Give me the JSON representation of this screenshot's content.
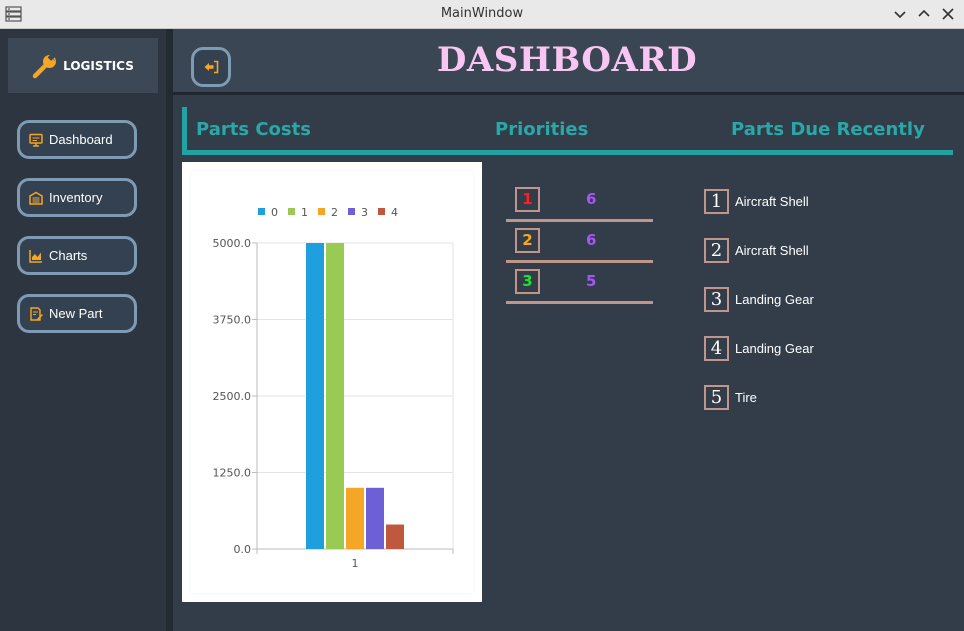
{
  "window": {
    "title": "MainWindow"
  },
  "sidebar": {
    "logo_label": "LOGISTICS",
    "items": [
      {
        "label": "Dashboard",
        "icon": "monitor-icon"
      },
      {
        "label": "Inventory",
        "icon": "warehouse-icon"
      },
      {
        "label": "Charts",
        "icon": "chart-icon"
      },
      {
        "label": "New Part",
        "icon": "edit-icon"
      }
    ]
  },
  "header": {
    "title": "DASHBOARD",
    "back_icon": "logout-icon"
  },
  "tabs": [
    "Parts Costs",
    "Priorities",
    "Parts Due Recently"
  ],
  "colors": {
    "accent": "#2aa7a7",
    "title": "#f8c6f2",
    "border": "#c0958a",
    "priority_value": "#a855f7"
  },
  "priorities": [
    {
      "rank": "1",
      "value": "6",
      "rank_color": "#ff1f1f"
    },
    {
      "rank": "2",
      "value": "6",
      "rank_color": "#f5a623"
    },
    {
      "rank": "3",
      "value": "5",
      "rank_color": "#22e02b"
    }
  ],
  "parts_due": [
    {
      "num": "1",
      "label": "Aircraft Shell"
    },
    {
      "num": "2",
      "label": "Aircraft Shell"
    },
    {
      "num": "3",
      "label": "Landing Gear"
    },
    {
      "num": "4",
      "label": "Landing Gear"
    },
    {
      "num": "5",
      "label": "Tire"
    }
  ],
  "chart_data": {
    "type": "bar",
    "categories": [
      "1"
    ],
    "series": [
      {
        "name": "0",
        "values": [
          5000
        ],
        "color": "#209fdf"
      },
      {
        "name": "1",
        "values": [
          5000
        ],
        "color": "#99ca53"
      },
      {
        "name": "2",
        "values": [
          1000
        ],
        "color": "#f6a625"
      },
      {
        "name": "3",
        "values": [
          1000
        ],
        "color": "#6d5fd5"
      },
      {
        "name": "4",
        "values": [
          400
        ],
        "color": "#bf593e"
      }
    ],
    "yticks": [
      "0.0",
      "1250.0",
      "2500.0",
      "3750.0",
      "5000.0"
    ],
    "ylim": [
      0,
      5000
    ],
    "legend": "top",
    "grid": true
  }
}
